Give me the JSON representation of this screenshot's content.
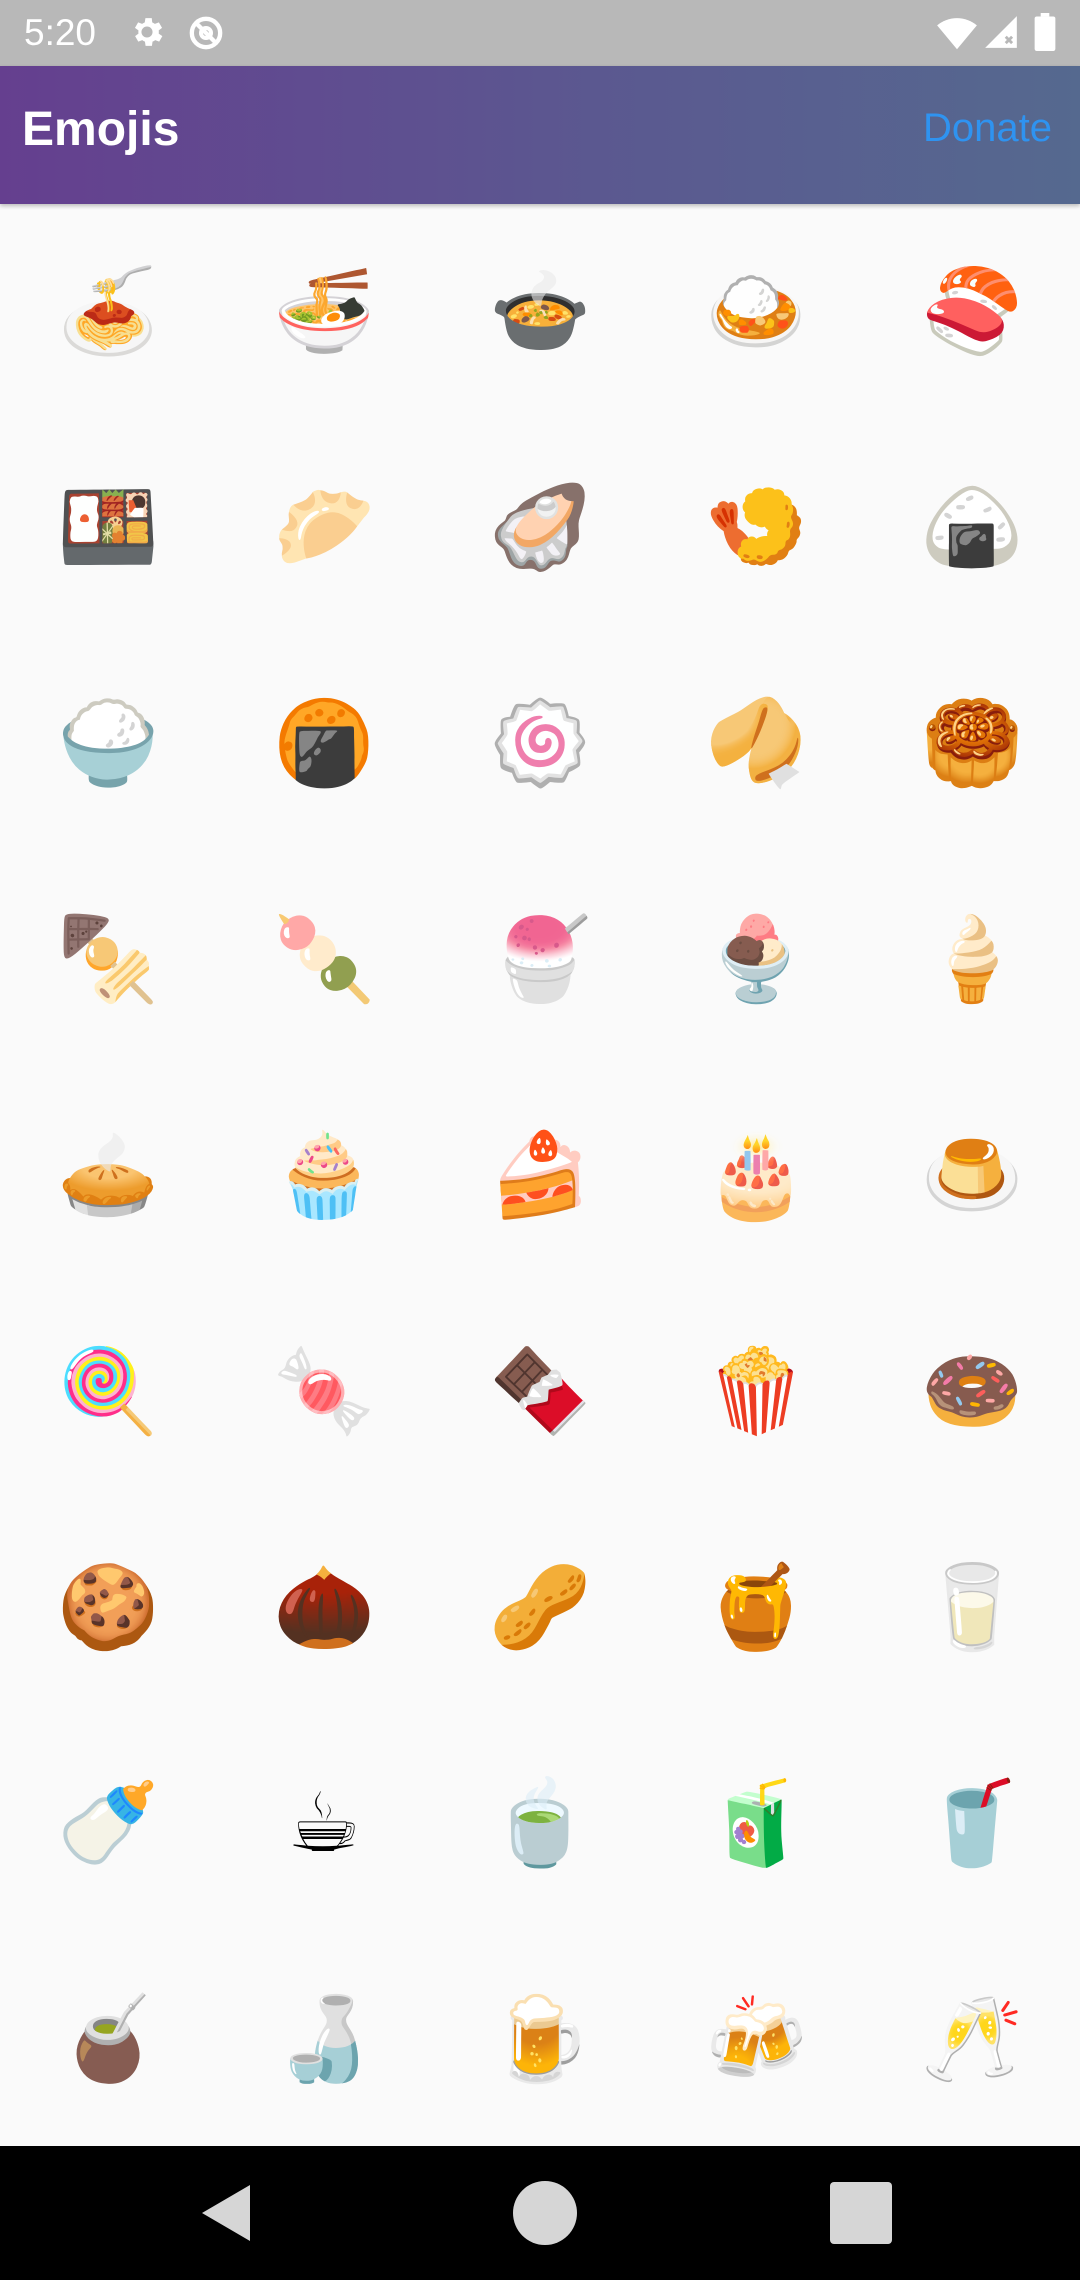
{
  "status_bar": {
    "time": "5:20",
    "icons": [
      "gear-icon",
      "sync-icon",
      "wifi-icon",
      "signal-icon",
      "battery-icon"
    ]
  },
  "app_bar": {
    "title": "Emojis",
    "donate_label": "Donate",
    "gradient_colors": [
      "#653f8f",
      "#55698f"
    ],
    "donate_color": "#2f93f0"
  },
  "emoji_grid": {
    "rows": [
      [
        "🍝",
        "🍜",
        "🍲",
        "🍛",
        "🍣"
      ],
      [
        "🍱",
        "🥟",
        "🦪",
        "🍤",
        "🍙"
      ],
      [
        "🍚",
        "🍘",
        "🍥",
        "🥠",
        "🥮"
      ],
      [
        "🍢",
        "🍡",
        "🍧",
        "🍨",
        "🍦"
      ],
      [
        "🥧",
        "🧁",
        "🍰",
        "🎂",
        "🍮"
      ],
      [
        "🍭",
        "🍬",
        "🍫",
        "🍿",
        "🍩"
      ],
      [
        "🍪",
        "🌰",
        "🥜",
        "🍯",
        "🥛"
      ],
      [
        "🍼",
        "☕",
        "🍵",
        "🧃",
        "🥤"
      ],
      [
        "🧉",
        "🍶",
        "🍺",
        "🍻",
        "🥂"
      ]
    ]
  },
  "nav_bar": {
    "buttons": [
      "back-icon",
      "home-icon",
      "recents-icon"
    ]
  }
}
